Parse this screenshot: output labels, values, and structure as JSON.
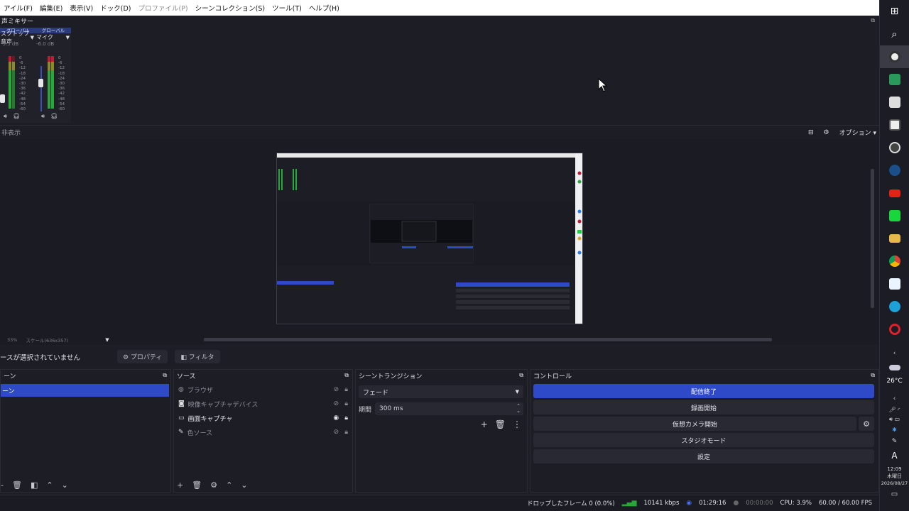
{
  "menu": [
    "アイル(F)",
    "編集(E)",
    "表示(V)",
    "ドック(D)",
    "プロファイル(P)",
    "シーンコレクション(S)",
    "ツール(T)",
    "ヘルプ(H)"
  ],
  "menu_disabled_index": 4,
  "mixer": {
    "title": "声ミキサー",
    "channels": [
      {
        "head": "グローバル",
        "name": "スクトップ音声",
        "db": "-5.5 dB"
      },
      {
        "head": "グローバル",
        "name": "マイク",
        "db": "-6.0 dB"
      }
    ],
    "scale": [
      "0",
      "-6",
      "-12",
      "-18",
      "-24",
      "-30",
      "-36",
      "-42",
      "-48",
      "-54",
      "-60"
    ]
  },
  "preview": {
    "left_label": "非表示",
    "options_label": "オプション",
    "zoom": "33%",
    "scale_label": "スケール(636x357)"
  },
  "props": {
    "no_source": "ースが選択されていません",
    "properties": "プロパティ",
    "filters": "フィルタ"
  },
  "scenes": {
    "title": "ーン",
    "items": [
      "ーン"
    ]
  },
  "sources": {
    "title": "ソース",
    "items": [
      {
        "label": "ブラウザ",
        "visible": false
      },
      {
        "label": "映像キャプチャデバイス",
        "visible": false
      },
      {
        "label": "画面キャプチャ",
        "visible": true
      },
      {
        "label": "色ソース",
        "visible": false
      }
    ]
  },
  "transitions": {
    "title": "シーントランジション",
    "selected": "フェード",
    "duration_label": "期間",
    "duration_value": "300 ms"
  },
  "controls": {
    "title": "コントロール",
    "stream": "配信終了",
    "record": "録画開始",
    "virtual_cam": "仮想カメラ開始",
    "studio": "スタジオモード",
    "settings": "設定"
  },
  "status": {
    "dropped": "ドロップしたフレーム 0 (0.0%)",
    "bitrate": "10141 kbps",
    "stream_time": "01:29:16",
    "rec_time": "00:00:00",
    "cpu": "CPU: 3.9%",
    "fps": "60.00 / 60.00 FPS"
  },
  "taskbar": {
    "weather": "26°C",
    "clock": "12:09",
    "day": "木曜日",
    "date": "2026/08/27",
    "ime": "A"
  },
  "colors": {
    "accent": "#2f4ac8",
    "panel": "#1d1e25",
    "meter_green": "#28a83a",
    "meter_red": "#c21a35"
  }
}
